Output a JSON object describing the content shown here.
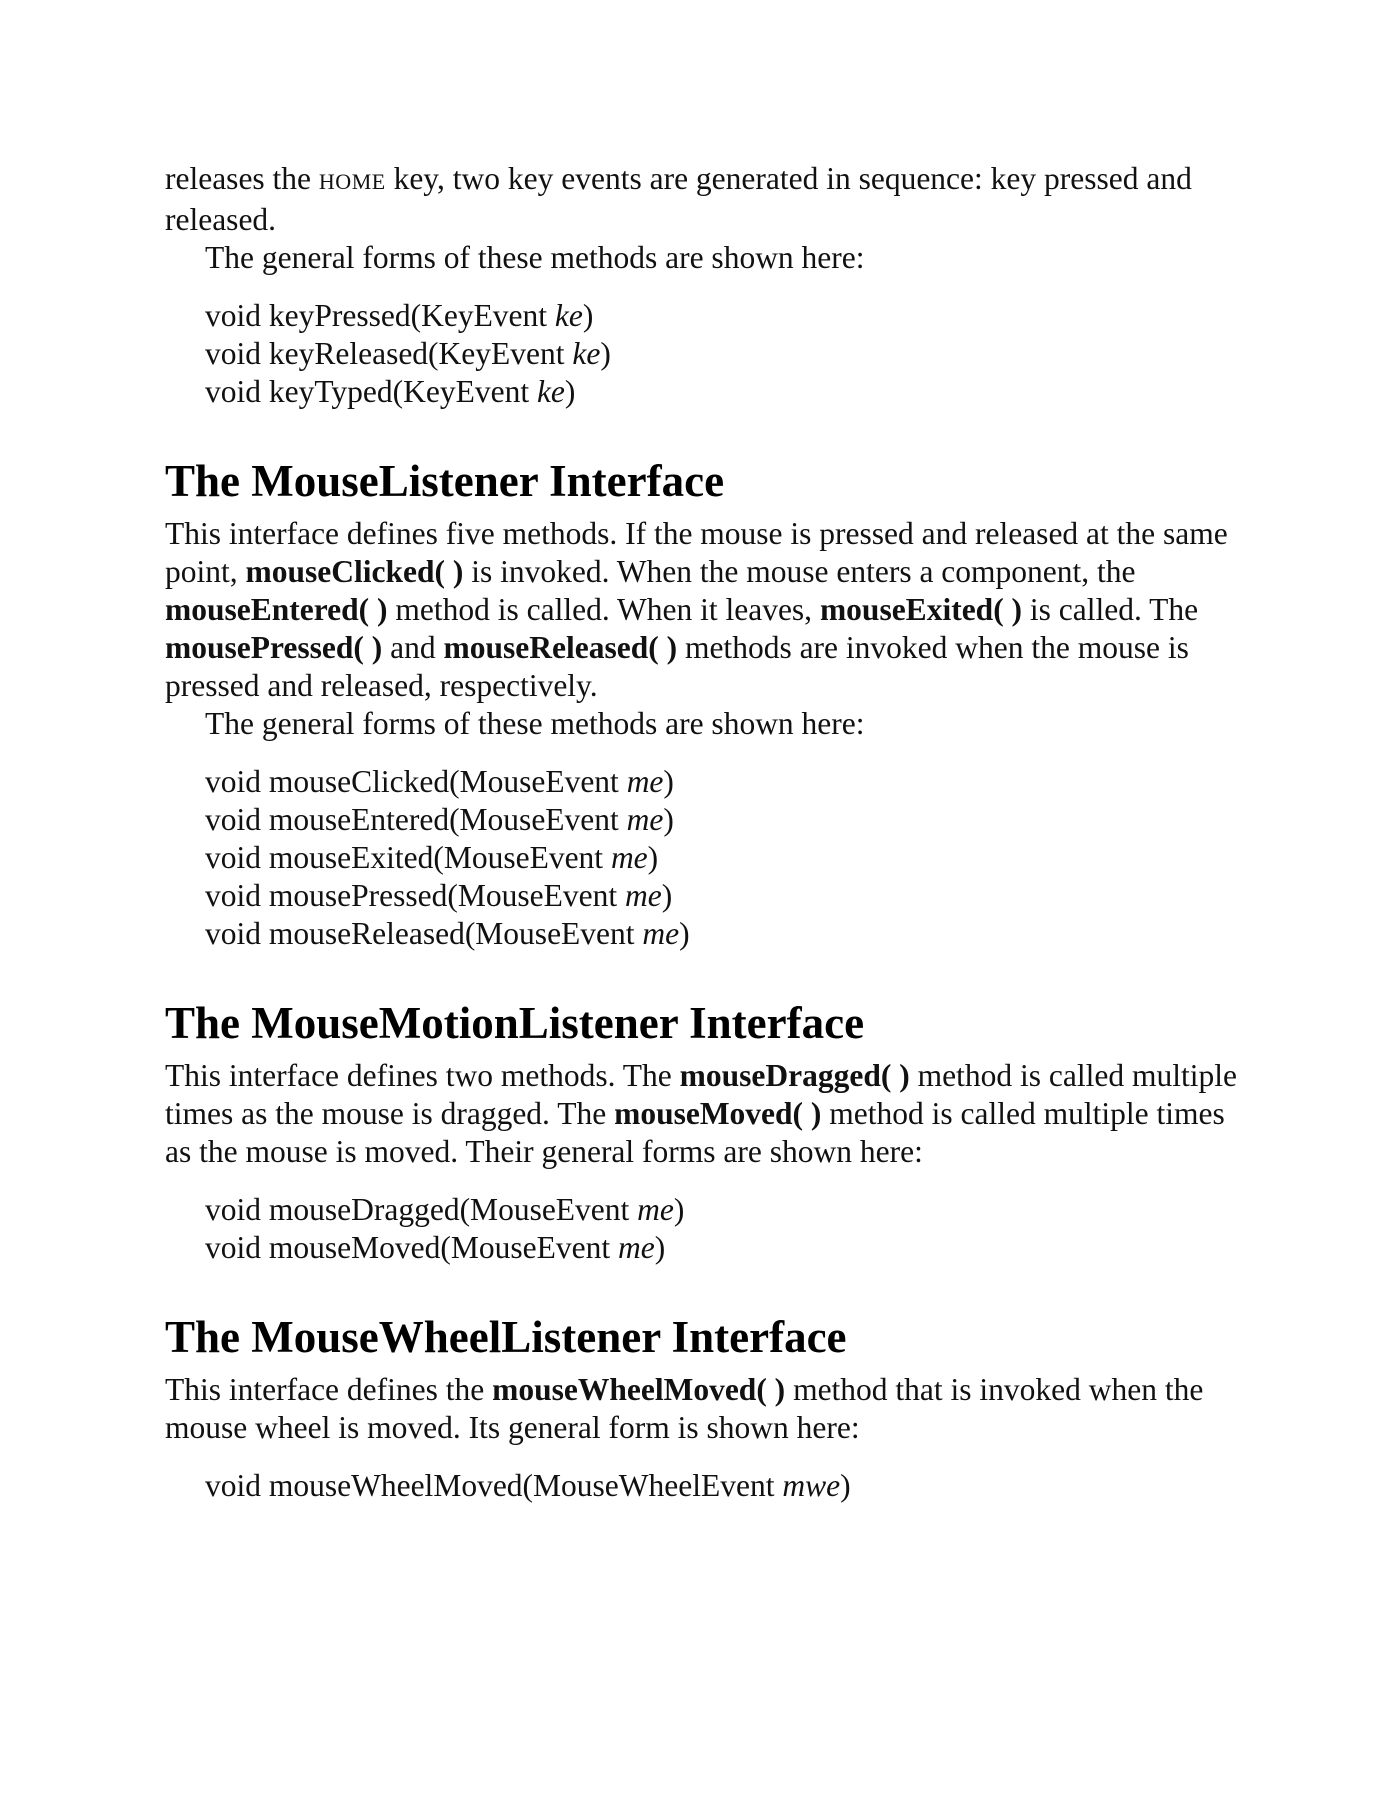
{
  "intro": {
    "line1_a": "releases the ",
    "home_key": "HOME",
    "line1_b": " key, two key events are generated in sequence: key pressed and released.",
    "forms_intro": "The general forms of these methods are shown here:",
    "code": [
      {
        "text": "void keyPressed(KeyEvent ",
        "param": "ke",
        "close": ")"
      },
      {
        "text": "void keyReleased(KeyEvent ",
        "param": "ke",
        "close": ")"
      },
      {
        "text": "void keyTyped(KeyEvent ",
        "param": "ke",
        "close": ")"
      }
    ]
  },
  "mouse_listener": {
    "heading": "The MouseListener Interface",
    "p1": "This interface defines five methods. If the mouse is pressed and released at the same point, ",
    "m1": "mouseClicked( )",
    "p2": " is invoked. When the mouse enters a component, the ",
    "m2": "mouseEntered( )",
    "p3": " method is called. When it leaves, ",
    "m3": "mouseExited( )",
    "p4": " is called. The ",
    "m4": "mousePressed( )",
    "p5": " and ",
    "m5": "mouseReleased( )",
    "p6": " methods are invoked when the mouse is pressed and released, respectively.",
    "forms_intro": "The general forms of these methods are shown here:",
    "code": [
      {
        "text": "void mouseClicked(MouseEvent ",
        "param": "me",
        "close": ")"
      },
      {
        "text": "void mouseEntered(MouseEvent ",
        "param": "me",
        "close": ")"
      },
      {
        "text": "void mouseExited(MouseEvent ",
        "param": "me",
        "close": ")"
      },
      {
        "text": "void mousePressed(MouseEvent ",
        "param": "me",
        "close": ")"
      },
      {
        "text": "void mouseReleased(MouseEvent ",
        "param": "me",
        "close": ")"
      }
    ]
  },
  "mouse_motion": {
    "heading": "The MouseMotionListener Interface",
    "p1": "This interface defines two methods. The ",
    "m1": "mouseDragged( )",
    "p2": " method is called multiple times as the mouse is dragged. The ",
    "m2": "mouseMoved( )",
    "p3": " method is called multiple times as the mouse is moved. Their general forms are shown here:",
    "code": [
      {
        "text": "void mouseDragged(MouseEvent ",
        "param": "me",
        "close": ")"
      },
      {
        "text": "void mouseMoved(MouseEvent ",
        "param": "me",
        "close": ")"
      }
    ]
  },
  "mouse_wheel": {
    "heading": "The MouseWheelListener Interface",
    "p1": "This interface defines the ",
    "m1": "mouseWheelMoved( )",
    "p2": " method that is invoked when the mouse wheel is moved. Its general form is shown here:",
    "code": [
      {
        "text": "void mouseWheelMoved(MouseWheelEvent ",
        "param": "mwe",
        "close": ")"
      }
    ]
  }
}
